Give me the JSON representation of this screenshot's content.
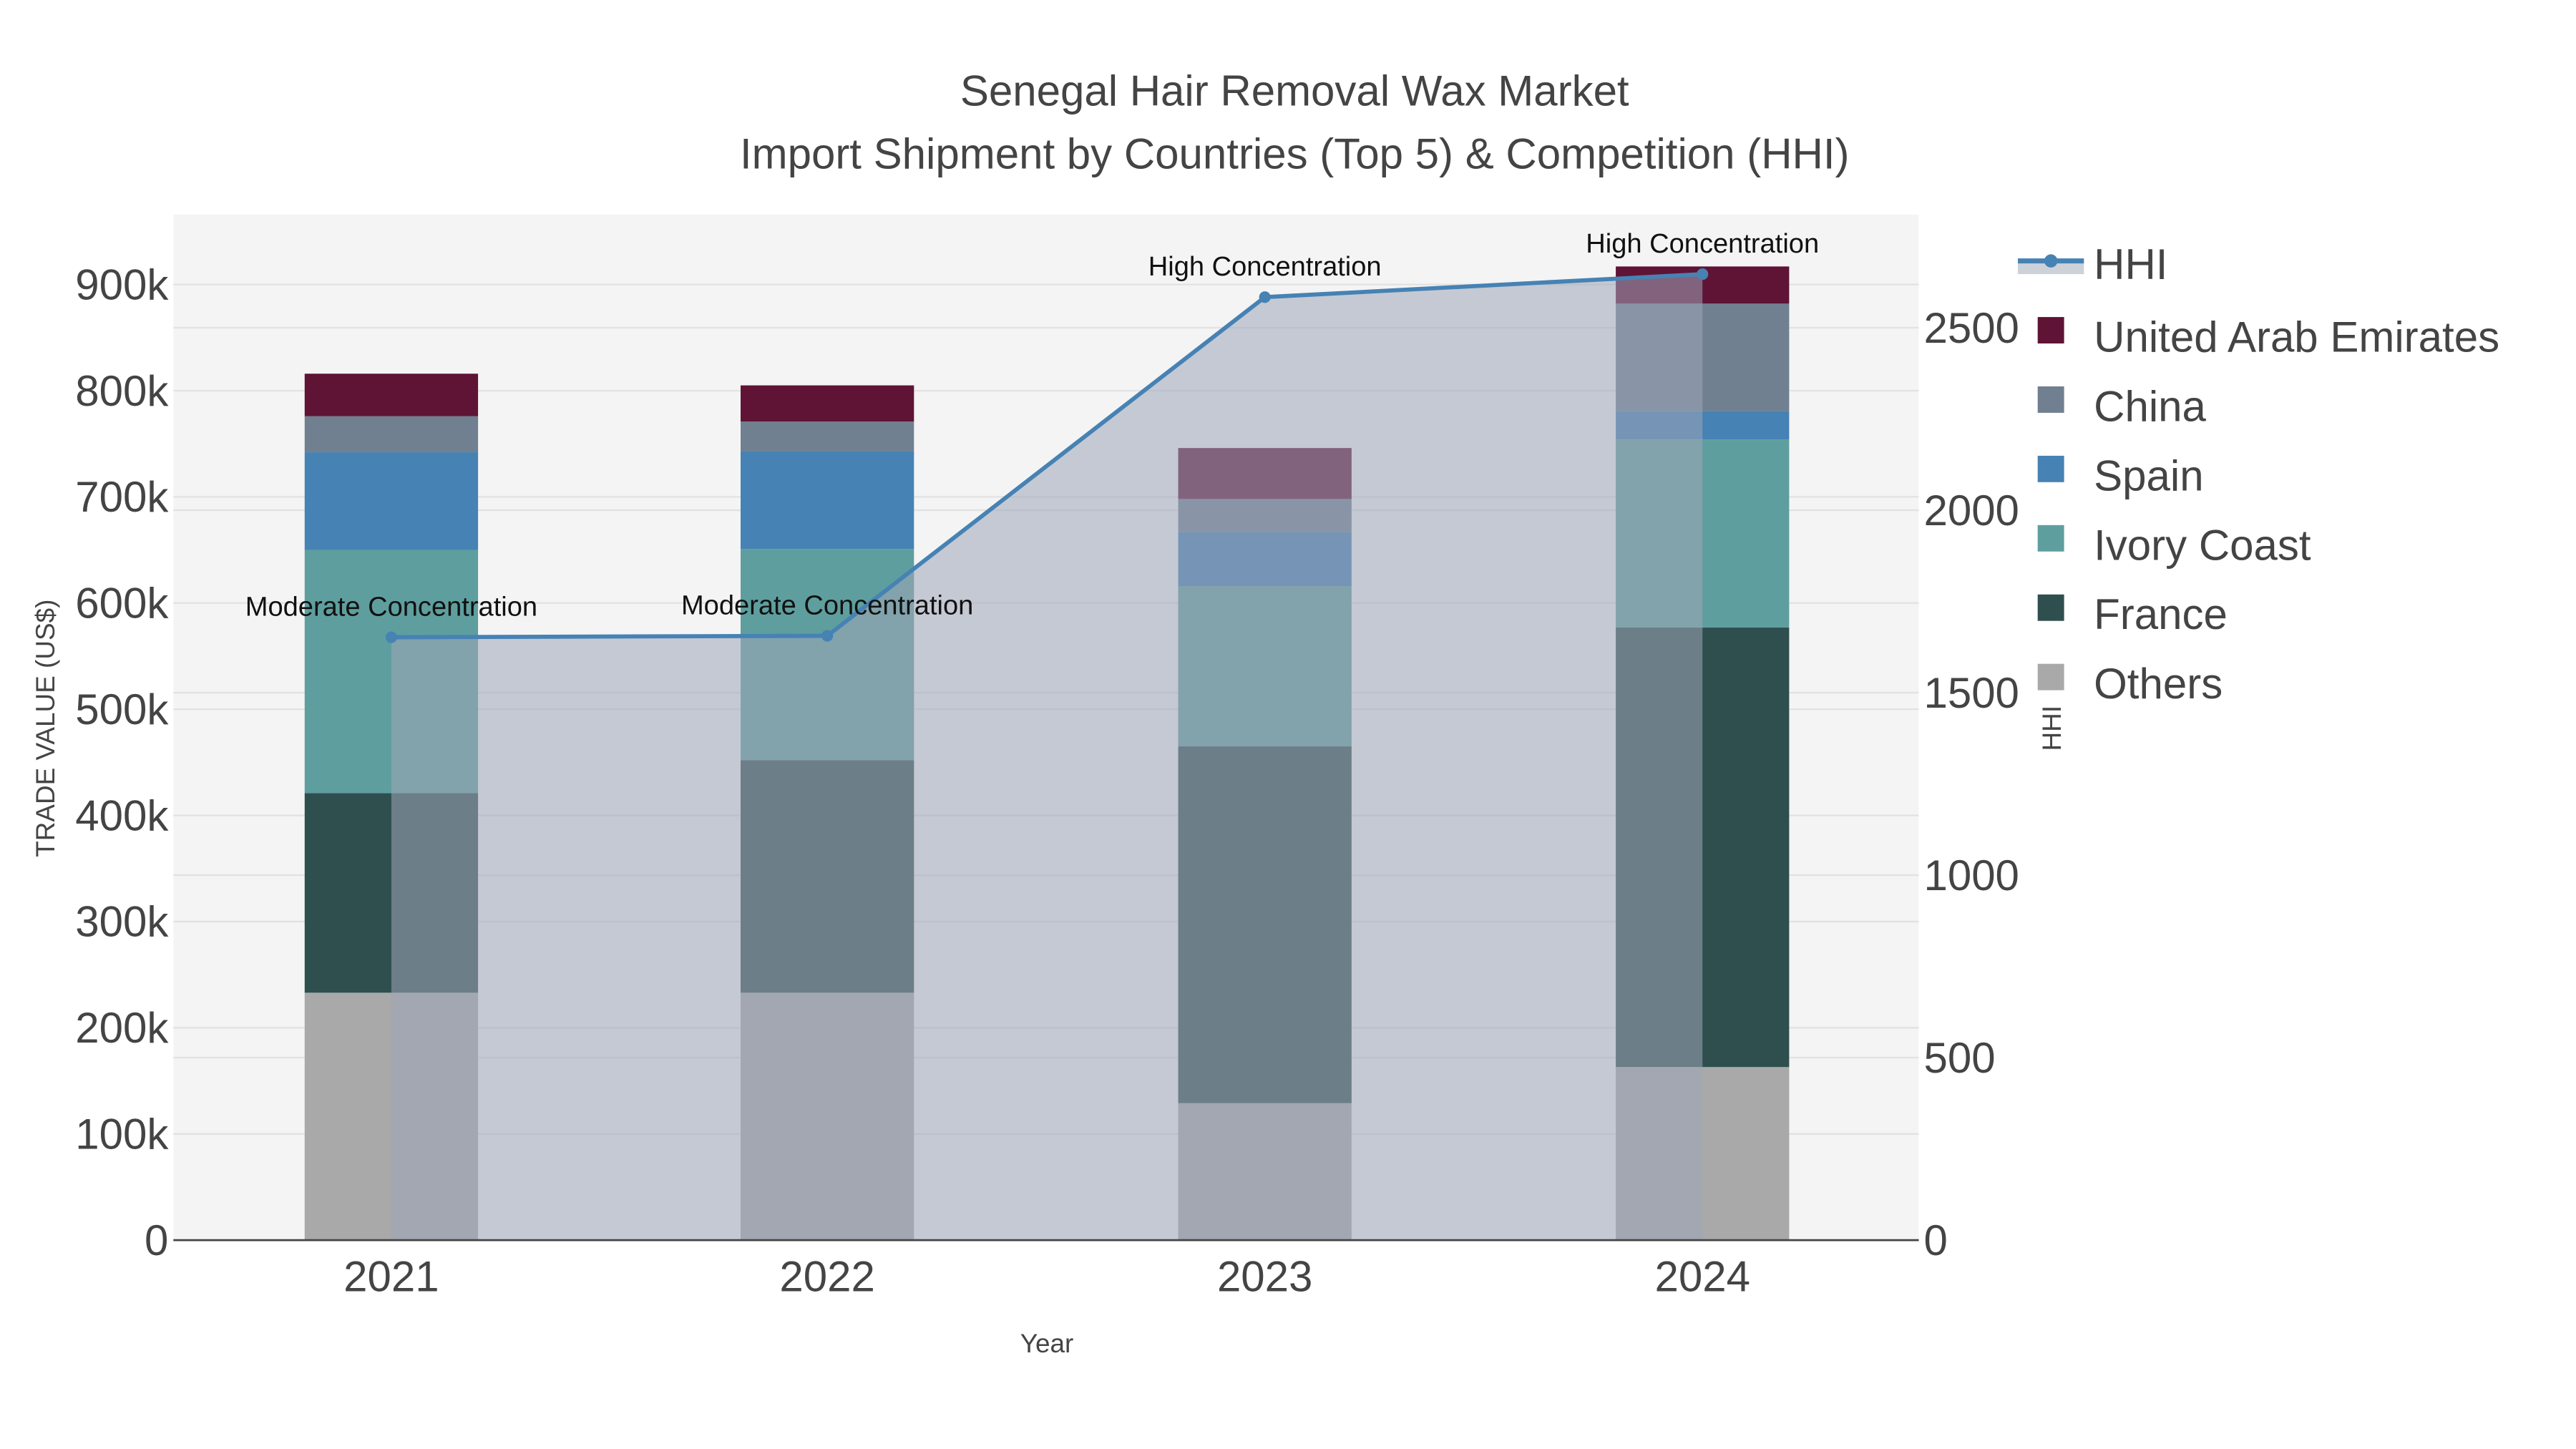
{
  "chart_data": {
    "type": "bar",
    "stacked": true,
    "title": "Senegal Hair Removal Wax Market",
    "subtitle": "Import Shipment by Countries (Top 5) & Competition (HHI)",
    "xlabel": "Year",
    "ylabel": "TRADE VALUE (US$)",
    "y2label": "HHI",
    "categories": [
      "2021",
      "2022",
      "2023",
      "2024"
    ],
    "ylim": [
      0,
      960000
    ],
    "y_ticks": [
      0,
      100000,
      200000,
      300000,
      400000,
      500000,
      600000,
      700000,
      800000,
      900000
    ],
    "y_tick_labels": [
      "0",
      "100k",
      "200k",
      "300k",
      "400k",
      "500k",
      "600k",
      "700k",
      "800k",
      "900k"
    ],
    "y2lim": [
      0,
      2800
    ],
    "y2_ticks": [
      0,
      500,
      1000,
      1500,
      2000,
      2500
    ],
    "y2_tick_labels": [
      "0",
      "500",
      "1000",
      "1500",
      "2000",
      "2500"
    ],
    "grid": true,
    "legend_position": "right",
    "series": [
      {
        "name": "Others",
        "color": "#a9a9a9",
        "values": [
          233000,
          233000,
          129000,
          163000
        ]
      },
      {
        "name": "France",
        "color": "#2f4f4f",
        "values": [
          188000,
          219000,
          336000,
          414000
        ]
      },
      {
        "name": "Ivory Coast",
        "color": "#5f9e9e",
        "values": [
          229000,
          199000,
          151000,
          177000
        ]
      },
      {
        "name": "Spain",
        "color": "#4682b4",
        "values": [
          92000,
          92000,
          51000,
          27000
        ]
      },
      {
        "name": "China",
        "color": "#708090",
        "values": [
          34000,
          28000,
          31000,
          101000
        ]
      },
      {
        "name": "United Arab Emirates",
        "color": "#5f1335",
        "values": [
          40000,
          34000,
          48000,
          35000
        ]
      }
    ],
    "line": {
      "name": "HHI",
      "color": "#4682b4",
      "values": [
        1652,
        1656,
        2584,
        2647
      ],
      "annotations": [
        "Moderate Concentration",
        "Moderate Concentration",
        "High Concentration",
        "High Concentration"
      ]
    },
    "legend": [
      "HHI",
      "United Arab Emirates",
      "China",
      "Spain",
      "Ivory Coast",
      "France",
      "Others"
    ]
  }
}
